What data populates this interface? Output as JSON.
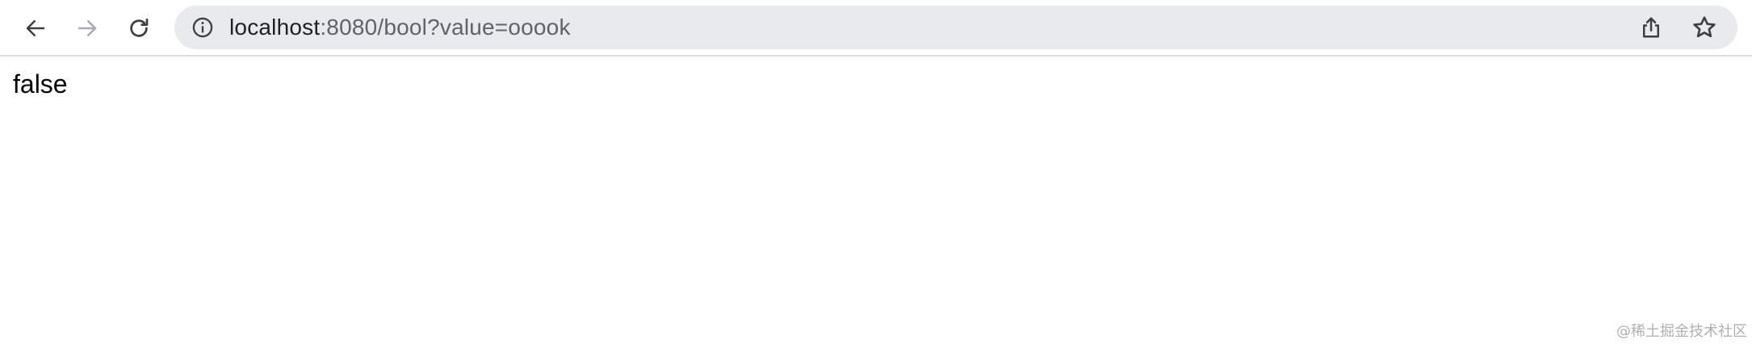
{
  "browser": {
    "url_host": "localhost",
    "url_rest": ":8080/bool?value=ooook",
    "icons": {
      "back": "back-arrow-icon",
      "forward": "forward-arrow-icon",
      "reload": "reload-icon",
      "site_info": "info-icon",
      "share": "share-icon",
      "bookmark": "star-icon"
    }
  },
  "page": {
    "body_text": "false"
  },
  "watermark": {
    "text": "@稀土掘金技术社区"
  }
}
